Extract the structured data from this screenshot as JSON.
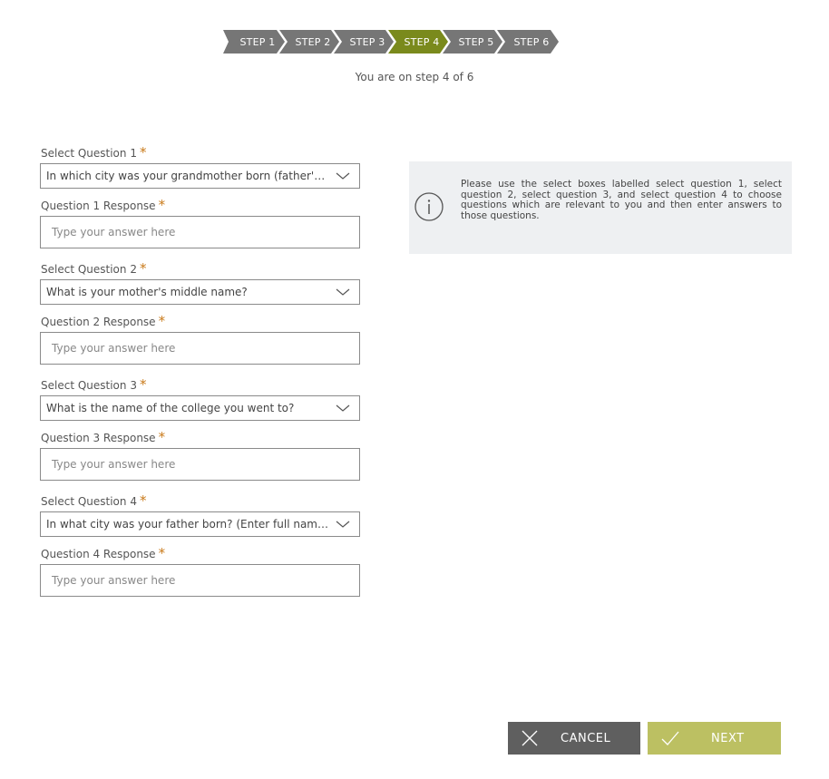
{
  "stepper": {
    "steps": [
      "STEP 1",
      "STEP 2",
      "STEP 3",
      "STEP 4",
      "STEP 5",
      "STEP 6"
    ],
    "active_index": 3,
    "active_color": "#7a8a1c",
    "inactive_color": "#767676",
    "status": "You are on step 4 of 6"
  },
  "form": {
    "required_marker": "*",
    "fields": [
      {
        "label": "Select Question 1",
        "type": "select",
        "value": "In which city was your grandmother born (father's m..."
      },
      {
        "label": "Question 1 Response",
        "type": "input",
        "placeholder": "Type your answer here"
      },
      {
        "label": "Select Question 2",
        "type": "select",
        "value": "What is your mother's middle name?"
      },
      {
        "label": "Question 2 Response",
        "type": "input",
        "placeholder": "Type your answer here"
      },
      {
        "label": "Select Question 3",
        "type": "select",
        "value": "What is the name of the college you went to?"
      },
      {
        "label": "Question 3 Response",
        "type": "input",
        "placeholder": "Type your answer here"
      },
      {
        "label": "Select Question 4",
        "type": "select",
        "value": "In what city was your father born? (Enter full name of ..."
      },
      {
        "label": "Question 4 Response",
        "type": "input",
        "placeholder": "Type your answer here"
      }
    ]
  },
  "info": {
    "icon": "info-icon",
    "text": "Please use the select boxes labelled select question 1, select question 2, select question 3, and select question 4 to choose questions which are relevant to you and then enter answers to those questions."
  },
  "buttons": {
    "cancel_label": "CANCEL",
    "next_label": "NEXT",
    "cancel_icon": "close-icon",
    "next_icon": "check-icon"
  }
}
